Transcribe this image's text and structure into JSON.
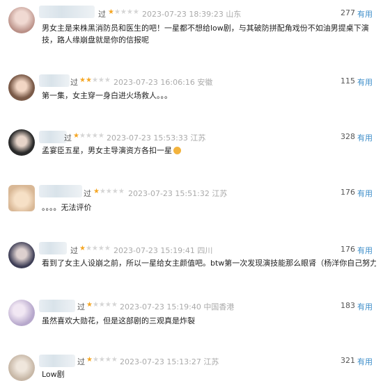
{
  "reviews": [
    {
      "watched": "过",
      "stars": 1,
      "time": "2023-07-23 18:39:23 山东",
      "count": "277",
      "useful": "有用",
      "text": "男女主是来株黑消防员和医生的吧！一星都不想给low剧，与其破防拼配角戏份不如油男提桌下演技，路人缘崩盘就是你的信报呢",
      "avatar_color": "#c9a7a0"
    },
    {
      "watched": "过",
      "stars": 2,
      "time": "2023-07-23 16:06:16 安徽",
      "count": "115",
      "useful": "有用",
      "text": "第一集，女主穿一身白进火场救人。。。",
      "avatar_color": "#8a6a55"
    },
    {
      "watched": "过",
      "stars": 1,
      "time": "2023-07-23 15:53:33 江苏",
      "count": "328",
      "useful": "有用",
      "text": "孟宴臣五星，男女主导演资方各扣一星",
      "avatar_color": "#3c3c3c"
    },
    {
      "watched": "过",
      "stars": 1,
      "time": "2023-07-23 15:51:32 江苏",
      "count": "176",
      "useful": "有用",
      "text": "。。。。无法评价",
      "avatar_color": "#e8c9a8"
    },
    {
      "watched": "过",
      "stars": 1,
      "time": "2023-07-23 15:19:41 四川",
      "count": "176",
      "useful": "有用",
      "text": "看到了女主人设崩之前，所以一星给女主颜值吧。btw第一次发现演技能那么眼肾（杨洋你自己努力吧",
      "avatar_color": "#4a4a5a"
    },
    {
      "watched": "过",
      "stars": 1,
      "time": "2023-07-23 15:19:40 中国香港",
      "count": "183",
      "useful": "有用",
      "text": "虽然喜欢大勋花，但是这部剧的三观真是炸裂",
      "avatar_color": "#c7b8d8"
    },
    {
      "watched": "过",
      "stars": 1,
      "time": "2023-07-23 15:13:27 江苏",
      "count": "321",
      "useful": "有用",
      "text": "Low剧",
      "avatar_color": "#d9cfc5"
    }
  ]
}
